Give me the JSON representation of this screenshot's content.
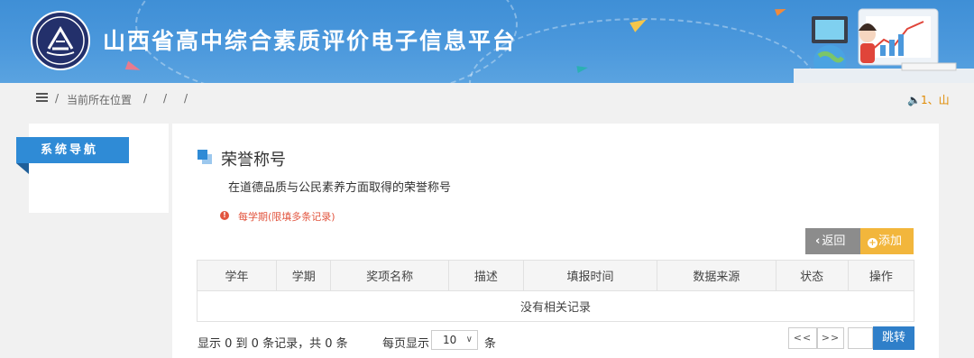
{
  "header": {
    "title": "山西省高中综合素质评价电子信息平台",
    "logo_icon": "school-emblem-icon",
    "brand_color": "#3f8fd6"
  },
  "breadcrumb": {
    "menu_icon": "hamburger-menu-icon",
    "current_location_label": "当前所在位置",
    "separator": "/",
    "notice_text": "🔈1、山"
  },
  "sidebar": {
    "nav_title": "系统导航"
  },
  "section": {
    "title": "荣誉称号",
    "description": "在道德品质与公民素养方面取得的荣誉称号",
    "warning_text": "每学期(限填多条记录)",
    "warning_icon": "exclamation-circle-icon",
    "warning_glyph": "!",
    "warning_color": "#e2553f"
  },
  "toolbar": {
    "back_label": "返回",
    "back_icon": "chevron-left-icon",
    "add_label": "添加",
    "add_icon": "plus-circle-icon"
  },
  "table": {
    "columns": [
      "学年",
      "学期",
      "奖项名称",
      "描述",
      "填报时间",
      "数据来源",
      "状态",
      "操作"
    ],
    "empty_text": "没有相关记录"
  },
  "pager": {
    "info": "显示 0 到 0 条记录，共 0 条",
    "per_page_label": "每页显示",
    "per_page_value": "10",
    "unit": "条",
    "prev_label": "<<",
    "next_label": ">>",
    "page_input": "",
    "jump_label": "跳转"
  }
}
